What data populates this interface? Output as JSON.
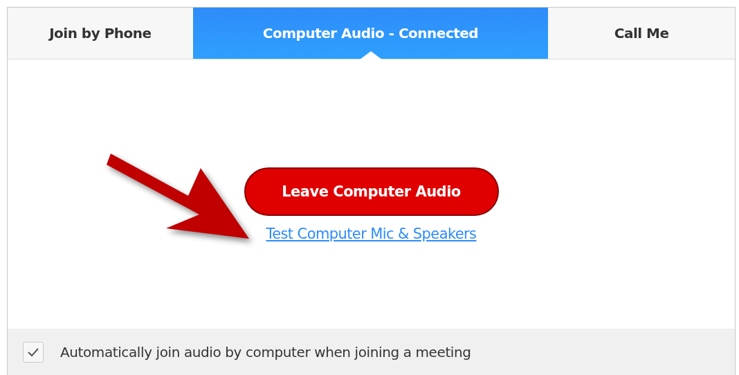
{
  "tabs": [
    {
      "label": "Join by Phone",
      "selected": false
    },
    {
      "label": "Computer Audio - Connected",
      "selected": true
    },
    {
      "label": "Call Me",
      "selected": false
    }
  ],
  "leave_button": "Leave Computer Audio",
  "test_link": "Test Computer Mic & Speakers",
  "auto_join": {
    "label": "Automatically join audio by computer when joining a meeting",
    "checked": true
  }
}
